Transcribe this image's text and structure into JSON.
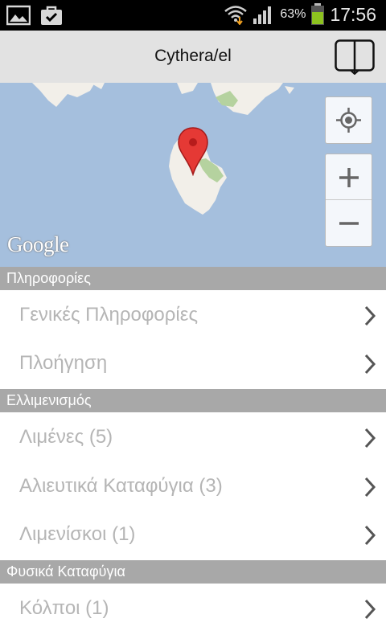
{
  "status_bar": {
    "battery_percent": "63%",
    "time": "17:56",
    "icons": [
      "gallery-icon",
      "task-check-icon",
      "wifi-icon",
      "signal-icon",
      "battery-icon"
    ]
  },
  "action_bar": {
    "title": "Cythera/el",
    "book_icon": "book-icon"
  },
  "map": {
    "logo": "Google",
    "controls": [
      "my-location-icon",
      "zoom-in-icon",
      "zoom-out-icon"
    ],
    "marker_icon": "map-pin-icon",
    "colors": {
      "water": "#a5bfdd",
      "land": "#f2efe9",
      "park": "#b5d29f",
      "marker": "#e53935"
    }
  },
  "sections": [
    {
      "header": "Πληροφορίες",
      "items": [
        {
          "label": "Γενικές Πληροφορίες"
        },
        {
          "label": "Πλοήγηση"
        }
      ]
    },
    {
      "header": "Ελλιμενισμός",
      "items": [
        {
          "label": "Λιμένες (5)"
        },
        {
          "label": "Αλιευτικά Καταφύγια (3)"
        },
        {
          "label": "Λιμενίσκοι (1)"
        }
      ]
    },
    {
      "header": "Φυσικά Καταφύγια",
      "items": [
        {
          "label": "Κόλποι  (1)"
        }
      ]
    }
  ]
}
